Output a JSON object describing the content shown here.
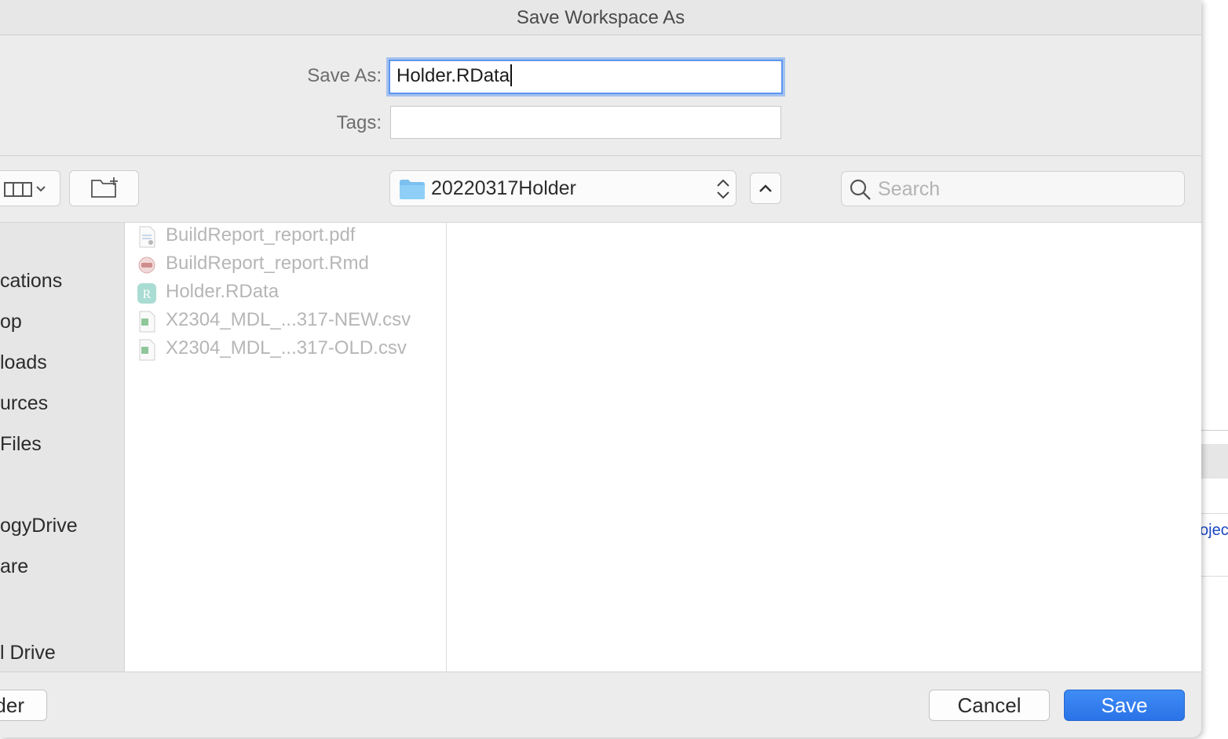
{
  "dialog": {
    "title": "Save Workspace As",
    "save_as_label": "Save As:",
    "save_as_value": "Holder.RData",
    "tags_label": "Tags:",
    "tags_value": ""
  },
  "toolbar": {
    "view_icon": "columns-view-icon",
    "new_folder_icon": "new-folder-icon",
    "location": "20220317Holder",
    "search_placeholder": "Search"
  },
  "sidebar": {
    "items": [
      "cations",
      "op",
      "loads",
      "urces",
      "Files",
      "ogyDrive",
      "are",
      "l Drive"
    ]
  },
  "files": [
    {
      "name": "BuildReport_report.pdf",
      "icon": "pdf-file-icon"
    },
    {
      "name": "BuildReport_report.Rmd",
      "icon": "rmd-file-icon"
    },
    {
      "name": "Holder.RData",
      "icon": "rdata-file-icon"
    },
    {
      "name": "X2304_MDL_...317-NEW.csv",
      "icon": "csv-file-icon"
    },
    {
      "name": "X2304_MDL_...317-OLD.csv",
      "icon": "csv-file-icon"
    }
  ],
  "buttons": {
    "new_folder": "der",
    "cancel": "Cancel",
    "save": "Save"
  },
  "background": {
    "link_fragment": "ojec"
  },
  "colors": {
    "accent": "#2a73e8",
    "focus_ring": "#6ca0f0"
  }
}
